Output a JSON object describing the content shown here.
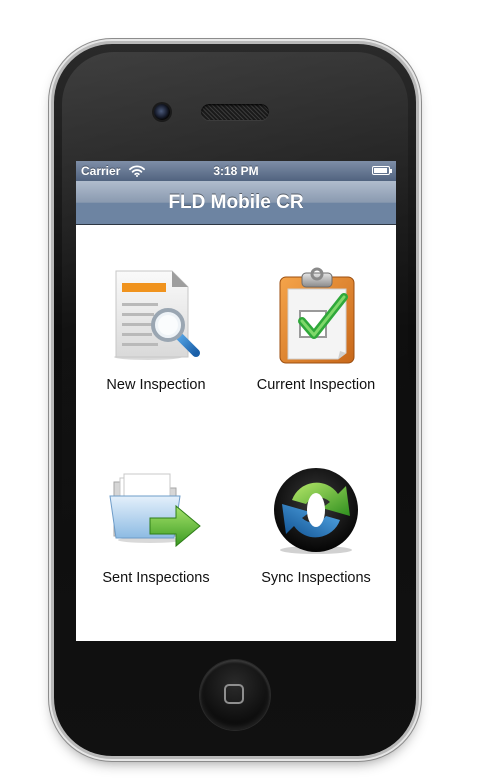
{
  "status_bar": {
    "carrier": "Carrier",
    "time": "3:18 PM",
    "battery_level": 0.9
  },
  "nav_bar": {
    "title": "FLD Mobile CR"
  },
  "menu": {
    "items": [
      {
        "label": "New Inspection",
        "icon": "new-inspection-icon"
      },
      {
        "label": "Current Inspection",
        "icon": "current-inspection-icon"
      },
      {
        "label": "Sent Inspections",
        "icon": "sent-inspections-icon"
      },
      {
        "label": "Sync Inspections",
        "icon": "sync-inspections-icon"
      }
    ]
  },
  "colors": {
    "nav_bar": "#6d84a2",
    "status_bar": "#51637f",
    "accent_green": "#39b54a",
    "accent_blue": "#2b8bd8",
    "accent_orange": "#e8891c"
  }
}
